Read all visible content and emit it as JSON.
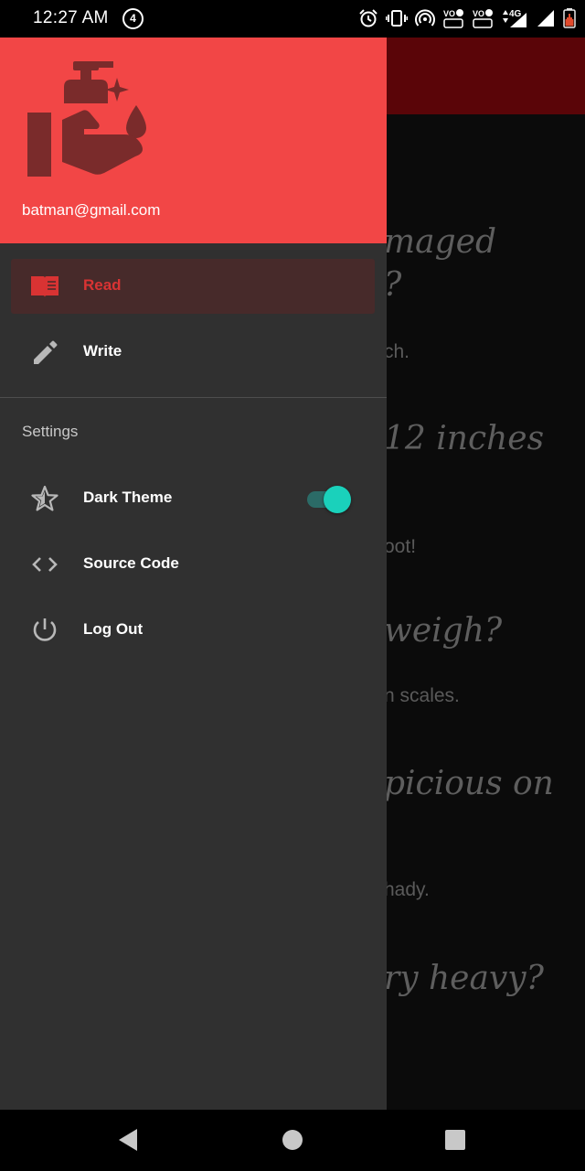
{
  "status_bar": {
    "time": "12:27 AM",
    "notification_count": "4",
    "lte_label": "LTE",
    "network_label": "4G"
  },
  "drawer": {
    "header": {
      "email": "batman@gmail.com",
      "color": "#f24646",
      "logo_icon": "hand-wash-icon"
    },
    "items": [
      {
        "label": "Read",
        "icon": "book-icon",
        "selected": true
      },
      {
        "label": "Write",
        "icon": "pencil-icon",
        "selected": false
      }
    ],
    "settings": {
      "title": "Settings",
      "items": [
        {
          "label": "Dark Theme",
          "icon": "star-icon",
          "toggle_on": true
        },
        {
          "label": "Source Code",
          "icon": "code-icon"
        },
        {
          "label": "Log Out",
          "icon": "power-icon"
        }
      ]
    }
  },
  "background_content": {
    "lines": [
      "maged",
      "?",
      "ch.",
      "12 inches",
      "oot!",
      "weigh?",
      "n scales.",
      "picious on",
      "hady.",
      "ry heavy?"
    ]
  },
  "colors": {
    "accent": "#1ad1bb",
    "selected_text": "#d93333",
    "appbar": "#5a0508"
  }
}
